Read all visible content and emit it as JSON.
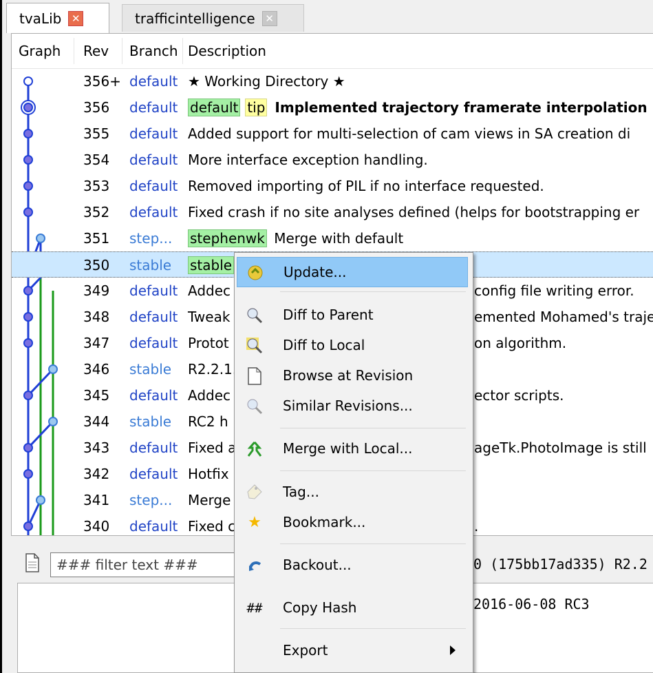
{
  "tabs": [
    {
      "label": "tvaLib",
      "close": "x"
    },
    {
      "label": "trafficintelligence",
      "close": "x"
    }
  ],
  "columns": {
    "graph": "Graph",
    "rev": "Rev",
    "branch": "Branch",
    "description": "Description"
  },
  "rows": [
    {
      "rev": "356+",
      "branch": "default",
      "desc": "★ Working Directory ★"
    },
    {
      "rev": "356",
      "branch": "default",
      "tag1": "default",
      "tag2": "tip",
      "desc": "Implemented trajectory framerate interpolation"
    },
    {
      "rev": "355",
      "branch": "default",
      "desc": "Added support for multi-selection of cam views in SA creation di"
    },
    {
      "rev": "354",
      "branch": "default",
      "desc": "More interface exception handling."
    },
    {
      "rev": "353",
      "branch": "default",
      "desc": "Removed importing of PIL if no interface requested."
    },
    {
      "rev": "352",
      "branch": "default",
      "desc": "Fixed crash if no site analyses defined (helps for bootstrapping er"
    },
    {
      "rev": "351",
      "branch": "step...",
      "tag1": "stephenwk",
      "desc": "Merge with default"
    },
    {
      "rev": "350",
      "branch": "stable",
      "tag1": "stable",
      "desc": ""
    },
    {
      "rev": "349",
      "branch": "default",
      "desc": "Addec",
      "desc_tail": "config file writing error."
    },
    {
      "rev": "348",
      "branch": "default",
      "desc": "Tweak",
      "desc_tail": "emented Mohamed's traje"
    },
    {
      "rev": "347",
      "branch": "default",
      "desc": "Protot",
      "desc_tail": "on algorithm."
    },
    {
      "rev": "346",
      "branch": "stable",
      "desc": "R2.2.1.",
      "desc_tail": ""
    },
    {
      "rev": "345",
      "branch": "default",
      "desc": "Addec",
      "desc_tail": "ector scripts."
    },
    {
      "rev": "344",
      "branch": "stable",
      "desc": "RC2 h",
      "desc_tail": ""
    },
    {
      "rev": "343",
      "branch": "default",
      "desc": "Fixed a",
      "desc_tail": "ageTk.PhotoImage is still"
    },
    {
      "rev": "342",
      "branch": "default",
      "desc": "Hotfix",
      "desc_tail": ""
    },
    {
      "rev": "341",
      "branch": "step...",
      "desc": "Merge",
      "desc_tail": ""
    },
    {
      "rev": "340",
      "branch": "default",
      "desc": "Fixed c",
      "desc_tail": "."
    }
  ],
  "filter": {
    "placeholder": "### filter text ###",
    "info": "0  (175bb17ad335) R2.2"
  },
  "detail": {
    "line1": "2016-06-08 RC3"
  },
  "menu": {
    "items": [
      {
        "label": "Update...",
        "icon": "update-icon"
      },
      {
        "label": "Diff to Parent",
        "icon": "magnifier-icon"
      },
      {
        "label": "Diff to Local",
        "icon": "magnifier-icon"
      },
      {
        "label": "Browse at Revision",
        "icon": "document-icon"
      },
      {
        "label": "Similar Revisions...",
        "icon": "magnifier-icon"
      },
      {
        "label": "Merge with Local...",
        "icon": "merge-icon"
      },
      {
        "label": "Tag...",
        "icon": "tag-icon"
      },
      {
        "label": "Bookmark...",
        "icon": "star-icon"
      },
      {
        "label": "Backout...",
        "icon": "backout-icon"
      },
      {
        "label": "Copy Hash",
        "icon": "hash-icon",
        "glyph": "##"
      },
      {
        "label": "Export",
        "icon": "submenu-arrow-icon"
      }
    ]
  },
  "colors": {
    "default_branch": "#2144c6",
    "stable_branch": "#3a7bd5",
    "selected_row": "#cce8ff",
    "menu_hover": "#91c9f7",
    "tag_green": "#a4f0a4",
    "tag_yellow": "#ffffa0"
  }
}
